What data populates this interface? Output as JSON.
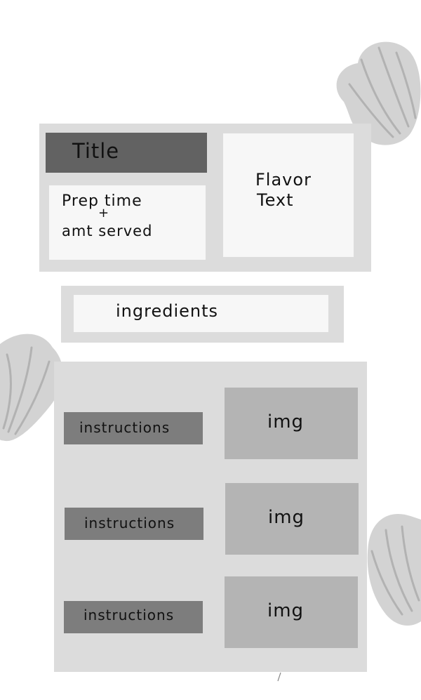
{
  "header_card": {
    "title": "Title",
    "prep_line1": "Prep time",
    "prep_plus": "+",
    "prep_line2": "amt served",
    "flavor_line1": "Flavor",
    "flavor_line2": "Text"
  },
  "ingredients": {
    "label": "ingredients"
  },
  "steps": [
    {
      "instruction": "instructions",
      "image": "img"
    },
    {
      "instruction": "instructions",
      "image": "img"
    },
    {
      "instruction": "instructions",
      "image": "img"
    }
  ],
  "colors": {
    "card_background": "#dcdcdc",
    "light_panel": "#f7f7f7",
    "title_bar": "#626262",
    "instruction_bar": "#7d7d7d",
    "image_box": "#b4b4b4",
    "shell_decoration": "#d3d3d3"
  },
  "decorations": [
    "shell-icon",
    "shell-icon",
    "shell-icon"
  ]
}
